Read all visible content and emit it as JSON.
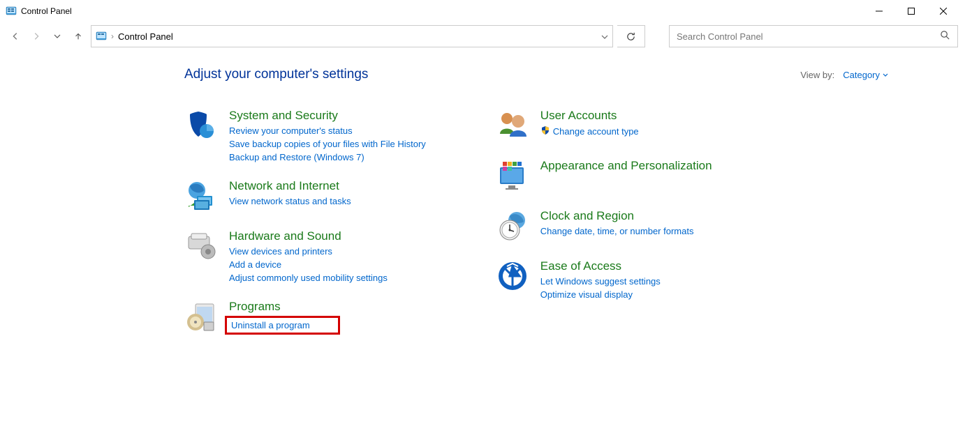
{
  "window": {
    "title": "Control Panel"
  },
  "address": {
    "crumb": "Control Panel"
  },
  "search": {
    "placeholder": "Search Control Panel"
  },
  "heading": "Adjust your computer's settings",
  "viewby": {
    "label": "View by:",
    "value": "Category"
  },
  "left": [
    {
      "title": "System and Security",
      "links": [
        "Review your computer's status",
        "Save backup copies of your files with File History",
        "Backup and Restore (Windows 7)"
      ]
    },
    {
      "title": "Network and Internet",
      "links": [
        "View network status and tasks"
      ]
    },
    {
      "title": "Hardware and Sound",
      "links": [
        "View devices and printers",
        "Add a device",
        "Adjust commonly used mobility settings"
      ]
    },
    {
      "title": "Programs",
      "links": [
        "Uninstall a program"
      ]
    }
  ],
  "right": [
    {
      "title": "User Accounts",
      "links": [
        "Change account type"
      ],
      "shielded": [
        true
      ]
    },
    {
      "title": "Appearance and Personalization",
      "links": []
    },
    {
      "title": "Clock and Region",
      "links": [
        "Change date, time, or number formats"
      ]
    },
    {
      "title": "Ease of Access",
      "links": [
        "Let Windows suggest settings",
        "Optimize visual display"
      ]
    }
  ]
}
